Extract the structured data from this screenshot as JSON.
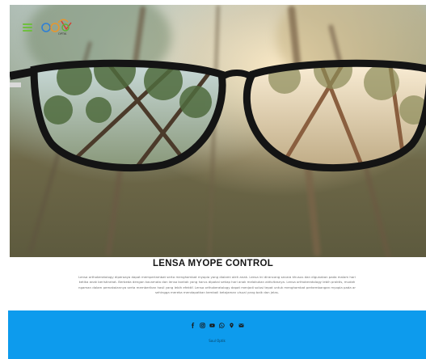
{
  "header": {
    "menu_icon": "hamburger-menu-icon",
    "logo_icon": "brand-logo-icon",
    "logo_text": "OPTIK"
  },
  "hero": {
    "image": "eyeglasses-over-blurred-forest"
  },
  "main": {
    "title": "LENSA MYOPE CONTROL",
    "description_lines": [
      "Lensa orthokeratology diperoaya dapat memperlambat serta menghambat myopia yang dialami oleh anak. Lensa ini dirancang secara khusus dan digunakan pada malam hari",
      "ketika anak beristirahat. Berbeda dengan kacamata dan lensa kontak yang harus dipakai setiap hari anak melakukan aktivitasnya. Lensa orthokeratology lebih praktis, mudah",
      "ngaman dalam pemakaiannya serta memberikan hasil yang lebih efektif. Lensa orthokeratology dapat menjadi solusi tepat untuk menghambat perkembangan myopia pada ar",
      "sehingga mereka mendapatkan kembali ketajaman visual yang baik dan jelas."
    ]
  },
  "footer": {
    "background": "#0d9bed",
    "social_icons": [
      "facebook-icon",
      "instagram-icon",
      "youtube-icon",
      "whatsapp-icon",
      "location-pin-icon",
      "email-icon"
    ],
    "link_label": "Soul Optik"
  }
}
